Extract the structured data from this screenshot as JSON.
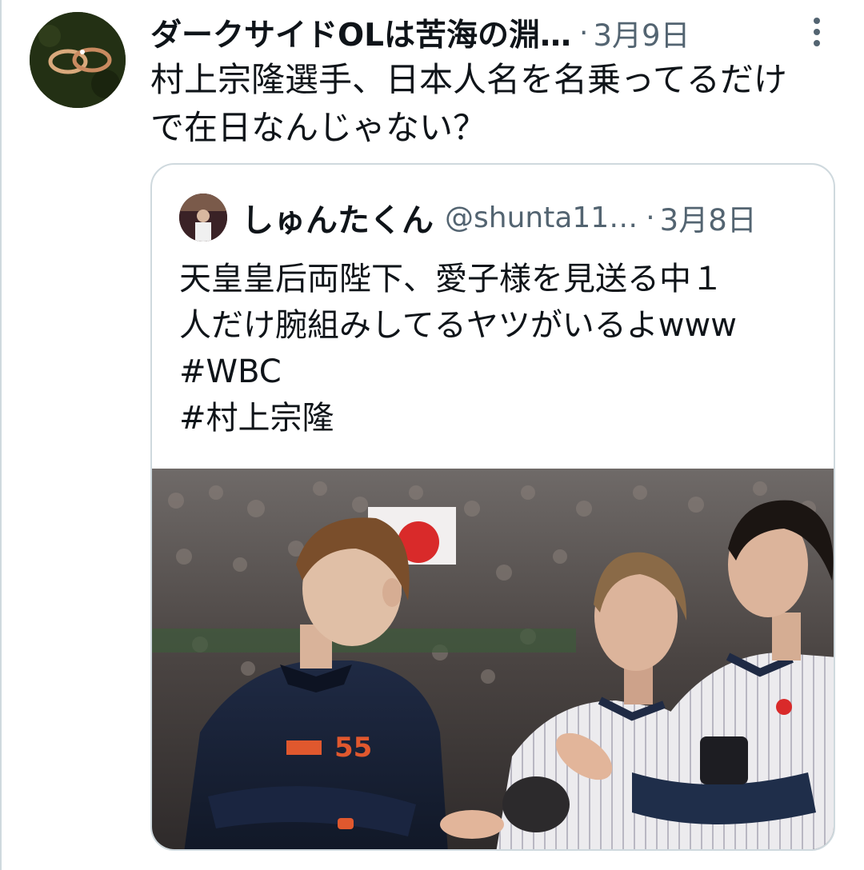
{
  "tweet": {
    "author_name": "ダークサイドOLは苦海の淵…",
    "separator": "·",
    "date": "3月9日",
    "text_lines": [
      "村上宗隆選手、日本人名を名乗ってるだけ",
      "で在日なんじゃない？"
    ],
    "more_icon": "more-vertical-icon"
  },
  "quoted_tweet": {
    "author_name": "しゅんたくん",
    "handle": "@shunta11…",
    "separator": "·",
    "date": "3月8日",
    "text_lines": [
      "天皇皇后両陛下、愛子様を見送る中１",
      "人だけ腕組みしてるヤツがいるよwww",
      "#WBC",
      "#村上宗隆"
    ],
    "jersey_number": "55"
  },
  "colors": {
    "text_primary": "#0f1419",
    "text_secondary": "#536471",
    "border": "#cfd9de"
  }
}
